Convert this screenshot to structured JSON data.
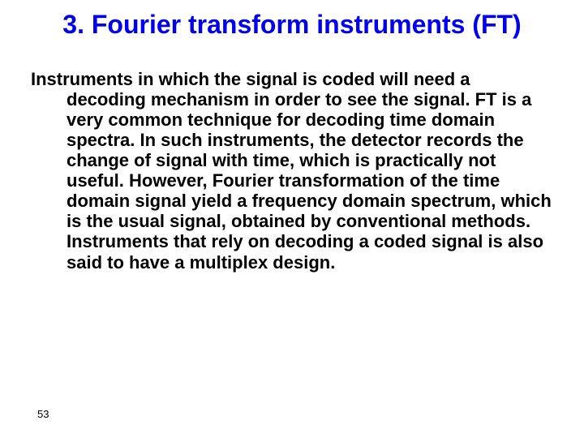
{
  "slide": {
    "title": "3. Fourier transform instruments (FT)",
    "body": "Instruments in which the signal is coded will need a decoding mechanism in order to see the signal. FT is a very common technique for decoding time domain spectra. In such instruments, the detector records the change of signal with time, which is practically not useful. However, Fourier transformation of the time domain signal yield a frequency domain spectrum, which is the usual signal, obtained by conventional methods. Instruments that rely on decoding a coded signal is also said to have a multiplex design.",
    "page_number": "53"
  }
}
